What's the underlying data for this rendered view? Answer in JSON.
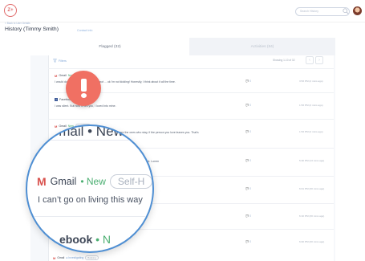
{
  "header": {
    "logo_text": "Z+",
    "search_placeholder": "Search History",
    "back_link": "< Back to User Details",
    "title": "History (Timmy Smith)",
    "contact_info": "Contact Info"
  },
  "tabs": [
    {
      "label": "Flagged (32)"
    },
    {
      "label": "Activities (84)"
    }
  ],
  "toolbar": {
    "filters_label": "Filters",
    "showing": "Showing 1-10 of 32"
  },
  "rows": [
    {
      "source": "Gmail",
      "status": "New",
      "tag": "Self-Harm",
      "text": "I would do anything for love but I do not ... ok i'm not kidding! Honestly, I think about it all the time.",
      "comments": "0",
      "time": "3:53 PM (2 mins ago)"
    },
    {
      "source": "Facebook",
      "status": "New",
      "tag": "Bullying",
      "text": "I was silent. But now I'll tell you, I loved into mine.",
      "comments": "0",
      "time": "1:53 PM (2 mins ago)"
    },
    {
      "source": "Gmail",
      "status": "New",
      "tag": "Self-Harm",
      "text": "we are the ones who stay, if the person you love leaves you. That's",
      "comments": "0",
      "time": "1:53 PM (2 mins ago)"
    },
    {
      "source": "Gmail",
      "status": "New",
      "tag": "Self-Harm",
      "text": "... you me a lot. and a lot. Lorem",
      "comments": "0",
      "time": "5:30 PM (13 mins ago)"
    },
    {
      "source": "Gmail",
      "status": "New",
      "tag": "Self-Harm",
      "text": "",
      "comments": "0",
      "time": "6:01 PM (30 mins ago)"
    },
    {
      "source": "Gmail",
      "status": "New",
      "tag": "Self-Harm",
      "text": "",
      "comments": "0",
      "time": "6:10 PM (30 mins ago)"
    },
    {
      "source": "Facebook",
      "status": "New",
      "tag": "Bullying",
      "text": "",
      "comments": "0",
      "time": "6:00 PM (30 mins ago)"
    }
  ],
  "magnifier": {
    "top_text": "Gmail • New",
    "source": "Gmail",
    "status": "New",
    "tag": "Self-H",
    "message": "I can’t go on living this way",
    "bottom_source": "ebook",
    "bottom_dot": "• N"
  },
  "bottom_row": {
    "source": "Gmail",
    "status": "Investigating",
    "tag": "Bullying"
  }
}
